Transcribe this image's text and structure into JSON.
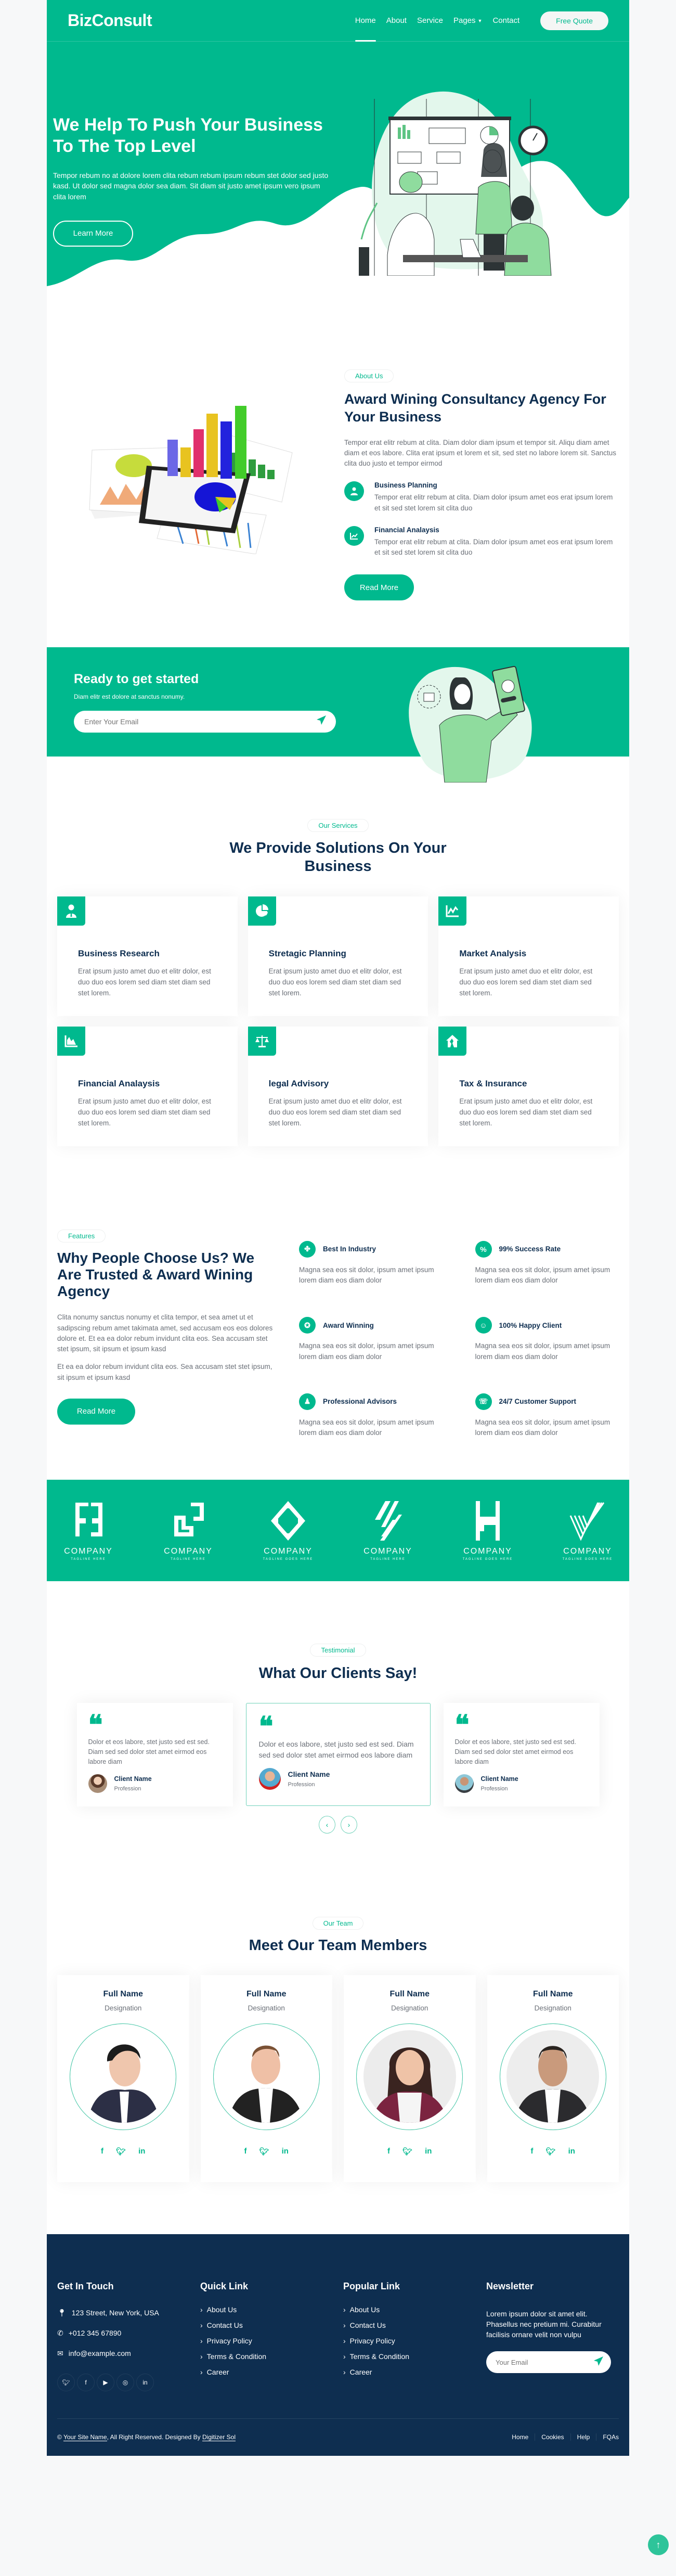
{
  "colors": {
    "primary": "#00b98e",
    "navy": "#0e2e50",
    "text": "#6b7078"
  },
  "header": {
    "brand": "BizConsult",
    "nav": [
      {
        "label": "Home",
        "active": true
      },
      {
        "label": "About"
      },
      {
        "label": "Service"
      },
      {
        "label": "Pages",
        "dropdown": true
      },
      {
        "label": "Contact"
      }
    ],
    "quote_button": "Free Quote"
  },
  "hero": {
    "title": "We Help To Push Your Business To The Top Level",
    "text": "Tempor rebum no at dolore lorem clita rebum rebum ipsum rebum stet dolor sed justo kasd. Ut dolor sed magna dolor sea diam. Sit diam sit justo amet ipsum vero ipsum clita lorem",
    "button": "Learn More",
    "illustration": "team-presentation-illustration"
  },
  "about": {
    "tag": "About Us",
    "title": "Award Wining Consultancy Agency For Your Business",
    "text": "Tempor erat elitr rebum at clita. Diam dolor diam ipsum et tempor sit. Aliqu diam amet diam et eos labore. Clita erat ipsum et lorem et sit, sed stet no labore lorem sit. Sanctus clita duo justo et tempor eirmod",
    "items": [
      {
        "icon": "user-tie-icon",
        "title": "Business Planning",
        "text": "Tempor erat elitr rebum at clita. Diam dolor ipsum amet eos erat ipsum lorem et sit sed stet lorem sit clita duo"
      },
      {
        "icon": "chart-line-icon",
        "title": "Financial Analaysis",
        "text": "Tempor erat elitr rebum at clita. Diam dolor ipsum amet eos erat ipsum lorem et sit sed stet lorem sit clita duo"
      }
    ],
    "button": "Read More",
    "image": "3d-charts-on-tablet"
  },
  "cta": {
    "title": "Ready to get started",
    "subtitle": "Diam elitr est dolore at sanctus nonumy.",
    "email_placeholder": "Enter Your Email",
    "illustration": "subscribe-girl-illustration"
  },
  "services": {
    "tag": "Our Services",
    "title": "We Provide Solutions On Your Business",
    "items": [
      {
        "icon": "user-tie-icon",
        "title": "Business Research",
        "text": "Erat ipsum justo amet duo et elitr dolor, est duo duo eos lorem sed diam stet diam sed stet lorem."
      },
      {
        "icon": "chart-pie-icon",
        "title": "Stretagic Planning",
        "text": "Erat ipsum justo amet duo et elitr dolor, est duo duo eos lorem sed diam stet diam sed stet lorem."
      },
      {
        "icon": "chart-line-icon",
        "title": "Market Analysis",
        "text": "Erat ipsum justo amet duo et elitr dolor, est duo duo eos lorem sed diam stet diam sed stet lorem."
      },
      {
        "icon": "chart-area-icon",
        "title": "Financial Analaysis",
        "text": "Erat ipsum justo amet duo et elitr dolor, est duo duo eos lorem sed diam stet diam sed stet lorem."
      },
      {
        "icon": "balance-scale-icon",
        "title": "legal Advisory",
        "text": "Erat ipsum justo amet duo et elitr dolor, est duo duo eos lorem sed diam stet diam sed stet lorem."
      },
      {
        "icon": "house-damage-icon",
        "title": "Tax & Insurance",
        "text": "Erat ipsum justo amet duo et elitr dolor, est duo duo eos lorem sed diam stet diam sed stet lorem."
      }
    ]
  },
  "features": {
    "tag": "Features",
    "title": "Why People Choose Us? We Are Trusted & Award Wining Agency",
    "text": "Clita nonumy sanctus nonumy et clita tempor, et sea amet ut et sadipscing rebum amet takimata amet, sed accusam eos eos dolores dolore et. Et ea ea dolor rebum invidunt clita eos. Sea accusam stet stet ipsum, sit ipsum et ipsum kasd",
    "text2": "Et ea ea dolor rebum invidunt clita eos. Sea accusam stet stet ipsum, sit ipsum et ipsum kasd",
    "button": "Read More",
    "items": [
      {
        "icon": "cubes-icon",
        "glyph": "✤",
        "title": "Best In Industry",
        "text": "Magna sea eos sit dolor, ipsum amet ipsum lorem diam eos diam dolor"
      },
      {
        "icon": "percent-icon",
        "glyph": "%",
        "title": "99% Success Rate",
        "text": "Magna sea eos sit dolor, ipsum amet ipsum lorem diam eos diam dolor"
      },
      {
        "icon": "award-icon",
        "glyph": "✪",
        "title": "Award Winning",
        "text": "Magna sea eos sit dolor, ipsum amet ipsum lorem diam eos diam dolor"
      },
      {
        "icon": "smile-icon",
        "glyph": "☺",
        "title": "100% Happy Client",
        "text": "Magna sea eos sit dolor, ipsum amet ipsum lorem diam eos diam dolor"
      },
      {
        "icon": "user-tie-icon",
        "glyph": "♟",
        "title": "Professional Advisors",
        "text": "Magna sea eos sit dolor, ipsum amet ipsum lorem diam eos diam dolor"
      },
      {
        "icon": "headset-icon",
        "glyph": "☏",
        "title": "24/7 Customer Support",
        "text": "Magna sea eos sit dolor, ipsum amet ipsum lorem diam eos diam dolor"
      }
    ]
  },
  "logos": [
    {
      "name": "COMPANY",
      "tagline": "TAGLINE HERE"
    },
    {
      "name": "COMPANY",
      "tagline": "TAGLINE HERE"
    },
    {
      "name": "COMPANY",
      "tagline": "TAGLINE GOES HERE"
    },
    {
      "name": "COMPANY",
      "tagline": "TAGLINE HERE"
    },
    {
      "name": "COMPANY",
      "tagline": "TAGLINE GOES HERE"
    },
    {
      "name": "COMPANY",
      "tagline": "TAGLINE GOES HERE"
    }
  ],
  "testimonials": {
    "tag": "Testimonial",
    "title": "What Our Clients Say!",
    "items": [
      {
        "text": "Dolor et eos labore, stet justo sed est sed. Diam sed sed dolor stet amet eirmod eos labore diam",
        "name": "Client Name",
        "profession": "Profession"
      },
      {
        "text": "Dolor et eos labore, stet justo sed est sed. Diam sed sed dolor stet amet eirmod eos labore diam",
        "name": "Client Name",
        "profession": "Profession",
        "active": true
      },
      {
        "text": "Dolor et eos labore, stet justo sed est sed. Diam sed sed dolor stet amet eirmod eos labore diam",
        "name": "Client Name",
        "profession": "Profession"
      }
    ],
    "prev": "‹",
    "next": "›"
  },
  "team": {
    "tag": "Our Team",
    "title": "Meet Our Team Members",
    "members": [
      {
        "name": "Full Name",
        "designation": "Designation"
      },
      {
        "name": "Full Name",
        "designation": "Designation"
      },
      {
        "name": "Full Name",
        "designation": "Designation"
      },
      {
        "name": "Full Name",
        "designation": "Designation"
      }
    ],
    "social": {
      "facebook": "f",
      "twitter": "🐦",
      "linkedin": "in"
    }
  },
  "footer": {
    "contact": {
      "heading": "Get In Touch",
      "address": "123 Street, New York, USA",
      "phone": "+012 345 67890",
      "email": "info@example.com"
    },
    "quick": {
      "heading": "Quick Link",
      "links": [
        "About Us",
        "Contact Us",
        "Privacy Policy",
        "Terms & Condition",
        "Career"
      ]
    },
    "popular": {
      "heading": "Popular Link",
      "links": [
        "About Us",
        "Contact Us",
        "Privacy Policy",
        "Terms & Condition",
        "Career"
      ]
    },
    "newsletter": {
      "heading": "Newsletter",
      "text": "Lorem ipsum dolor sit amet elit. Phasellus nec pretium mi. Curabitur facilisis ornare velit non vulpu",
      "placeholder": "Your Email"
    },
    "copyright_prefix": "© ",
    "site_name": "Your Site Name",
    "copyright_mid": ", All Right Reserved. Designed By ",
    "designer": "Digitizer Sol",
    "bottom_links": [
      "Home",
      "Cookies",
      "Help",
      "FQAs"
    ],
    "back_to_top": "↑"
  }
}
